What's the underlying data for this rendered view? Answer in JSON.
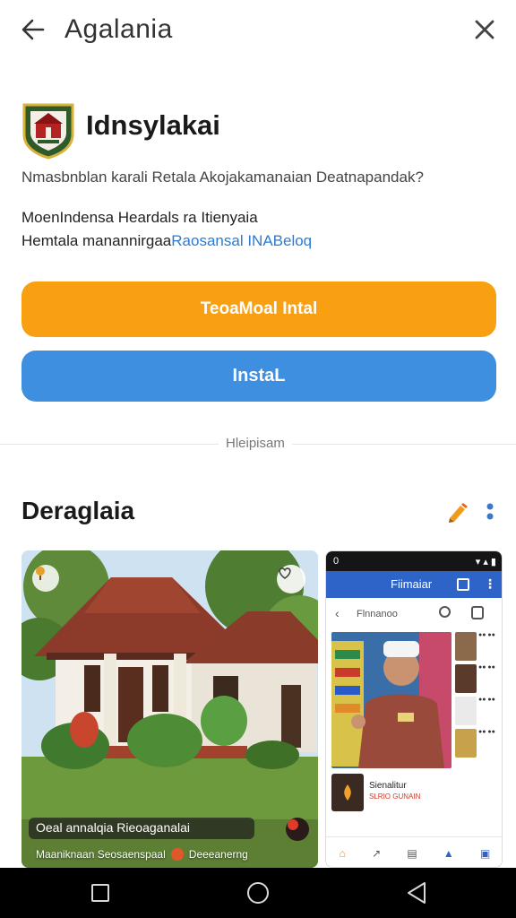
{
  "header": {
    "title": "Agalania"
  },
  "app": {
    "name": "Idnsylakai",
    "question": "Nmasbnblan karali Retala Akojakamanaian Deatnapandak?",
    "desc_line1": "MoenIndensa Heardals ra Itienyaia",
    "desc_line2_prefix": "Hemtala manannirgaa",
    "desc_line2_link": "Raosansal INABeloq"
  },
  "buttons": {
    "primary": "TeoaMoal Intal",
    "install": "InstaL"
  },
  "divider": {
    "label": "Hleipisam"
  },
  "section": {
    "title": "Deraglaia"
  },
  "screenshot1": {
    "caption": "Oeal annalqia Rieoaganalai",
    "subcaption_left": "Maaniknaan Seosaenspaal",
    "subcaption_right": "Deeeanerng"
  },
  "screenshot2": {
    "status_time": "0",
    "appbar_title": "Fiimaiar",
    "search_text": "Flnnanoo",
    "item_name": "Sienalitur",
    "item_sub": "SLRIO GUNAIN"
  },
  "colors": {
    "primary_orange": "#f9a012",
    "install_blue": "#3f8fe0",
    "link": "#2a7bd3",
    "appbar": "#2e63c8"
  },
  "icons": [
    "back-arrow-icon",
    "close-icon",
    "app-logo-shield",
    "edit-pencil-icon",
    "more-vertical-icon",
    "pin-icon",
    "heart-icon",
    "record-icon",
    "nav-recent-icon",
    "nav-home-icon",
    "nav-back-icon"
  ]
}
